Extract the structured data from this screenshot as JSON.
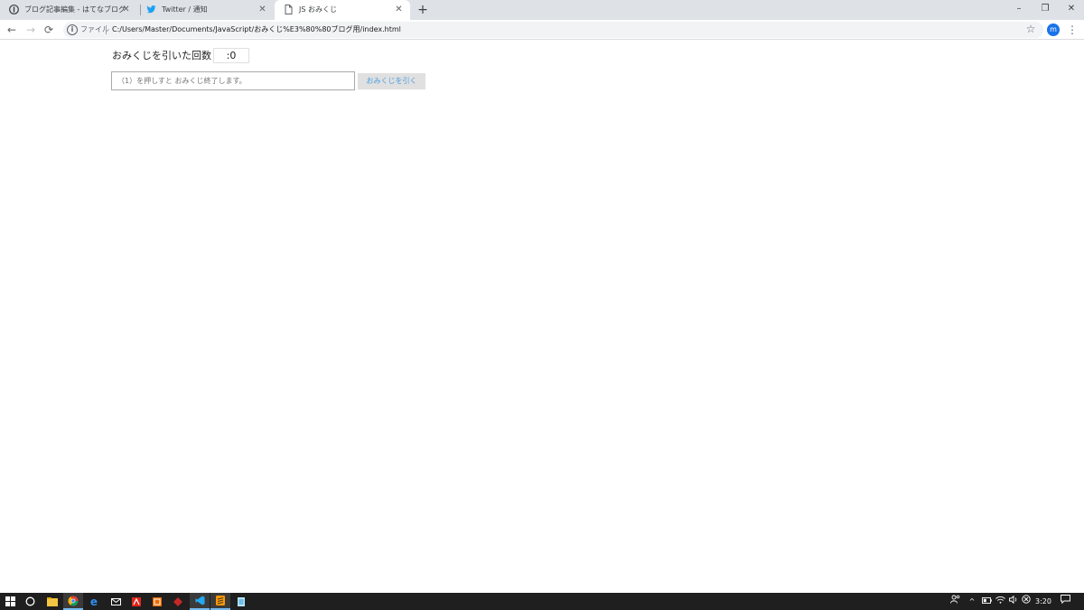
{
  "browser": {
    "tabs": [
      {
        "title": "ブログ記事編集 - はてなブログ",
        "icon": "hatena-icon",
        "active": false
      },
      {
        "title": "Twitter / 通知",
        "icon": "twitter-icon",
        "active": false
      },
      {
        "title": "JS おみくじ",
        "icon": "document-icon",
        "active": true
      }
    ],
    "new_tab_label": "+",
    "window": {
      "minimize": "–",
      "restore": "❐",
      "close": "✕"
    },
    "toolbar": {
      "back": "←",
      "forward": "→",
      "reload": "⟳",
      "info_icon": "i",
      "scheme_label": "ファイル",
      "url": "C:/Users/Master/Documents/JavaScript/おみくじ%E3%80%80ブログ用/index.html",
      "bookmark": "☆",
      "profile_initial": "m",
      "menu": "⋮"
    }
  },
  "page": {
    "count_label": "おみくじを引いた回数",
    "count_value": ":0",
    "input_placeholder": "（1）を押しすと おみくじ終了します。",
    "input_value": "",
    "draw_button_label": "おみくじを引く"
  },
  "taskbar": {
    "clock": "3:20"
  },
  "colors": {
    "tabstrip_bg": "#dee1e6",
    "accent": "#1a73e8",
    "button_text": "#4a9fe0",
    "button_bg": "#e0e0e0",
    "taskbar_bg": "#1f1f1f"
  }
}
